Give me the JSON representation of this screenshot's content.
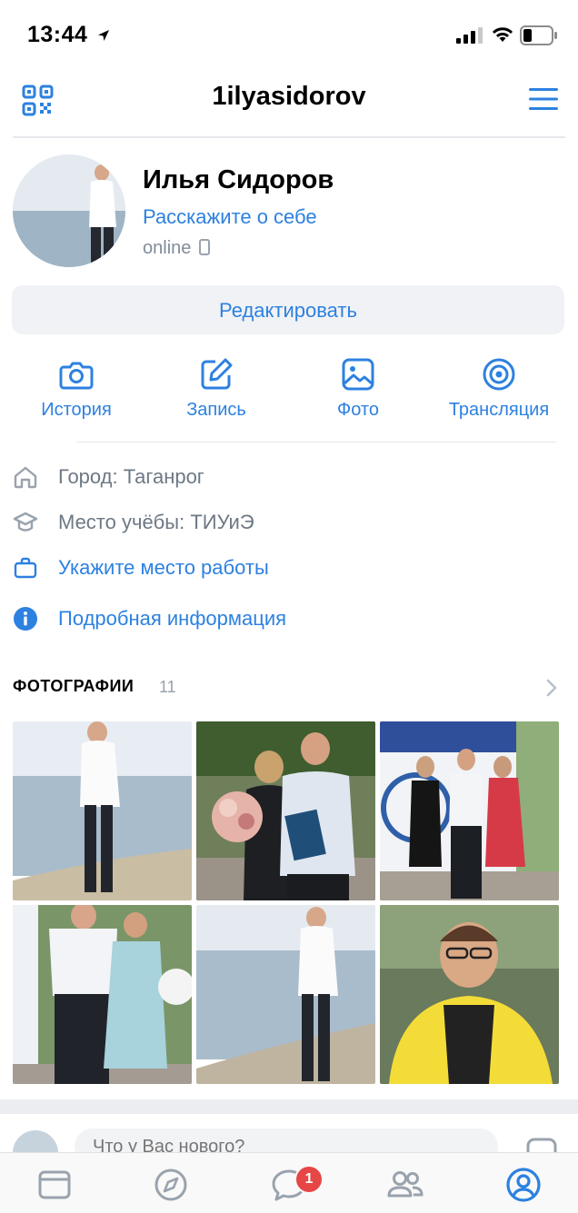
{
  "status_bar": {
    "time": "13:44"
  },
  "header": {
    "username": "1ilyasidorov"
  },
  "profile": {
    "name": "Илья Сидоров",
    "about": "Расскажите о себе",
    "status": "online",
    "edit_label": "Редактировать"
  },
  "actions": [
    {
      "label": "История",
      "icon": "camera-icon"
    },
    {
      "label": "Запись",
      "icon": "edit-icon"
    },
    {
      "label": "Фото",
      "icon": "photo-icon"
    },
    {
      "label": "Трансляция",
      "icon": "broadcast-icon"
    }
  ],
  "info": [
    {
      "text": "Город: Таганрог",
      "icon": "home-icon"
    },
    {
      "text": "Место учёбы: ТИУиЭ",
      "icon": "education-icon"
    },
    {
      "text": "Укажите место работы",
      "icon": "briefcase-icon"
    },
    {
      "text": "Подробная информация",
      "icon": "info-icon"
    }
  ],
  "photos": {
    "title": "ФОТОГРАФИИ",
    "count": "11"
  },
  "composer": {
    "placeholder": "Что у Вас нового?"
  },
  "tabbar": {
    "messages_badge": "1"
  },
  "colors": {
    "accent": "#2d81e0",
    "badge": "#e64646",
    "secondary_text": "#6d7885"
  }
}
